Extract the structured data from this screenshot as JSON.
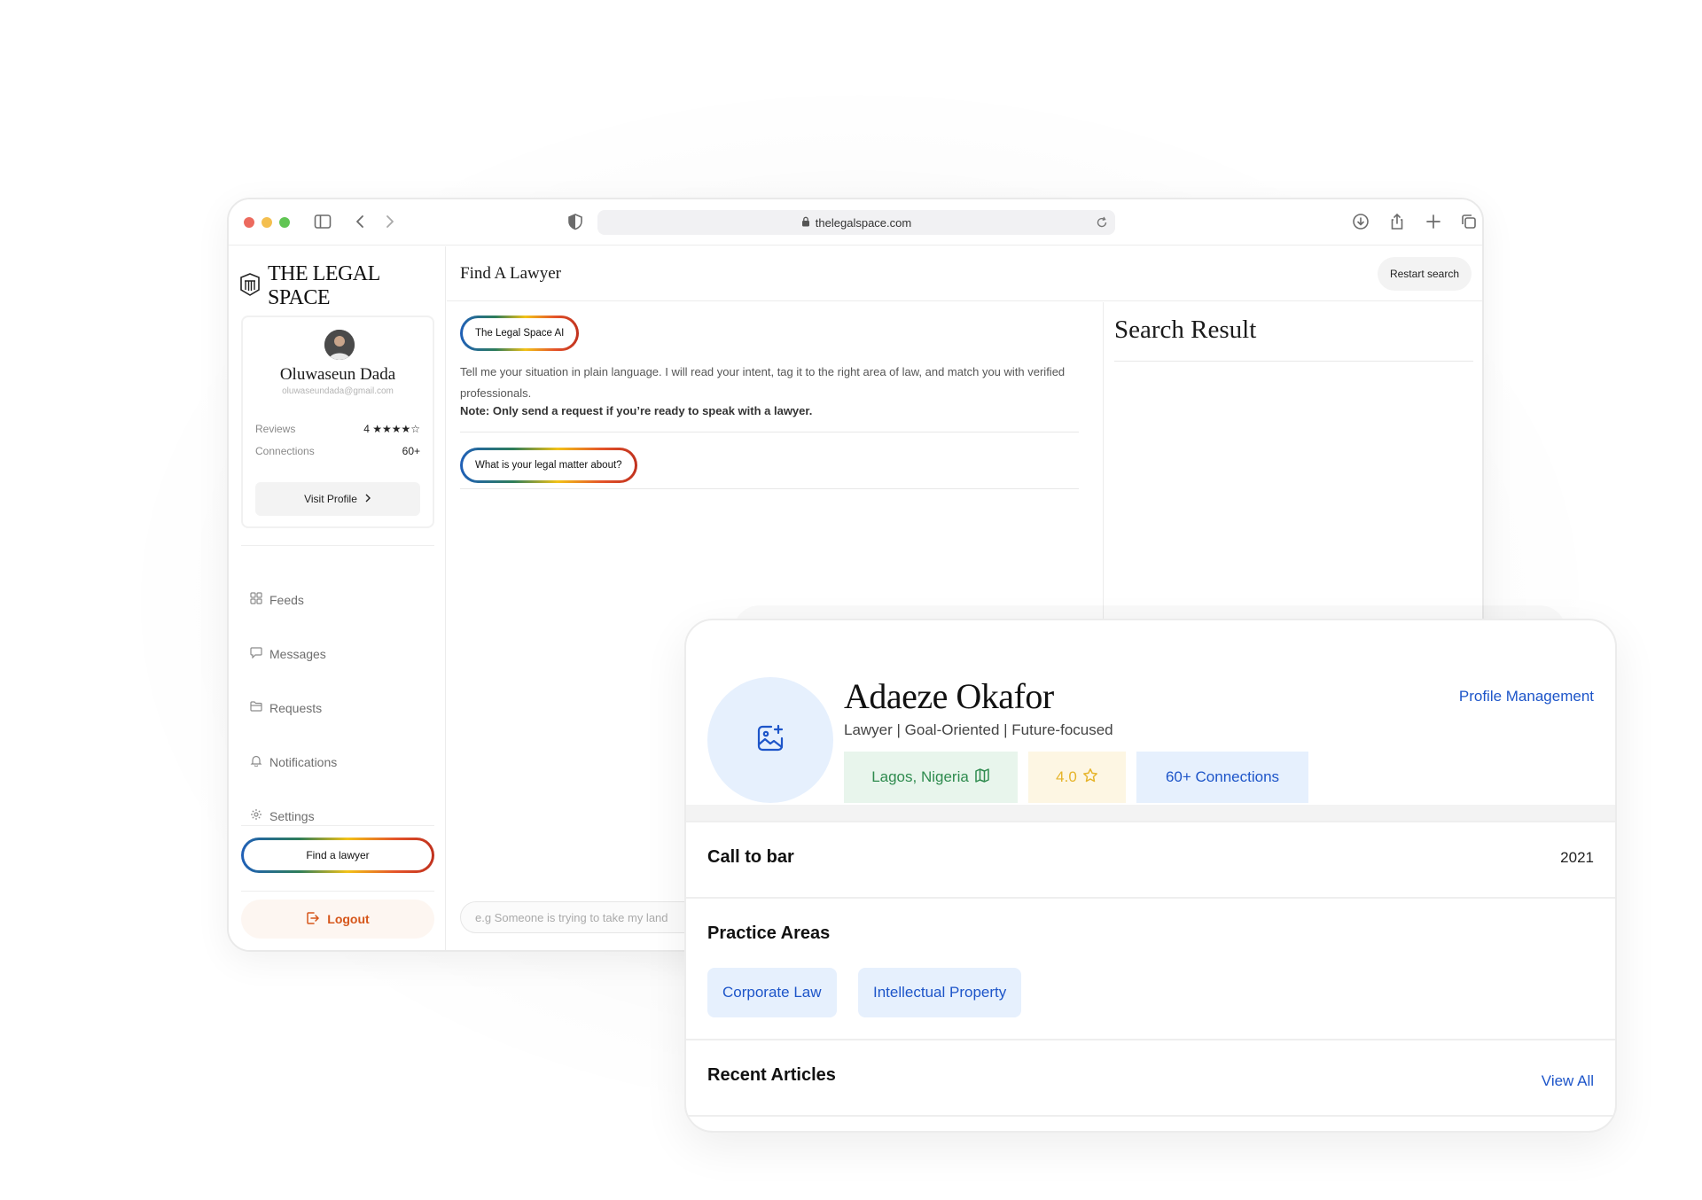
{
  "browser": {
    "url": "thelegalspace.com"
  },
  "brand": {
    "name": "THE LEGAL SPACE"
  },
  "user": {
    "name": "Oluwaseun Dada",
    "email": "oluwaseundada@gmail.com",
    "reviews_label": "Reviews",
    "reviews_value": "4 ★★★★☆",
    "connections_label": "Connections",
    "connections_value": "60+",
    "visit_profile": "Visit Profile"
  },
  "nav": {
    "items": [
      {
        "label": "Feeds",
        "icon": "grid-icon"
      },
      {
        "label": "Messages",
        "icon": "chat-bubble-icon"
      },
      {
        "label": "Requests",
        "icon": "folder-icon"
      },
      {
        "label": "Notifications",
        "icon": "bell-icon"
      },
      {
        "label": "Settings",
        "icon": "gear-icon"
      }
    ],
    "find_lawyer": "Find a lawyer",
    "logout": "Logout"
  },
  "main": {
    "title": "Find A Lawyer",
    "restart": "Restart search",
    "ai_badge": "The Legal Space AI",
    "intro": "Tell me your situation in plain language. I will read your intent, tag it to the right area of law, and match you with verified professionals.",
    "note": "Note: Only send a request if you’re ready to speak with a lawyer.",
    "question": "What is your legal matter about?",
    "input_placeholder": "e.g Someone is trying to take my land",
    "results_title": "Search Result"
  },
  "lawyer": {
    "name": "Adaeze Okafor",
    "tagline": "Lawyer | Goal-Oriented | Future-focused",
    "manage": "Profile Management",
    "location": "Lagos, Nigeria",
    "rating": "4.0",
    "connections": "60+ Connections",
    "call_to_bar_label": "Call to bar",
    "call_to_bar_year": "2021",
    "practice_label": "Practice Areas",
    "practice_areas": [
      "Corporate Law",
      "Intellectual Property"
    ],
    "articles_label": "Recent Articles",
    "view_all": "View All"
  },
  "colors": {
    "accent_blue": "#1d55c9",
    "location_green": "#2e8b4e",
    "rating_gold": "#e6b42a",
    "logout_orange": "#d6561a"
  }
}
